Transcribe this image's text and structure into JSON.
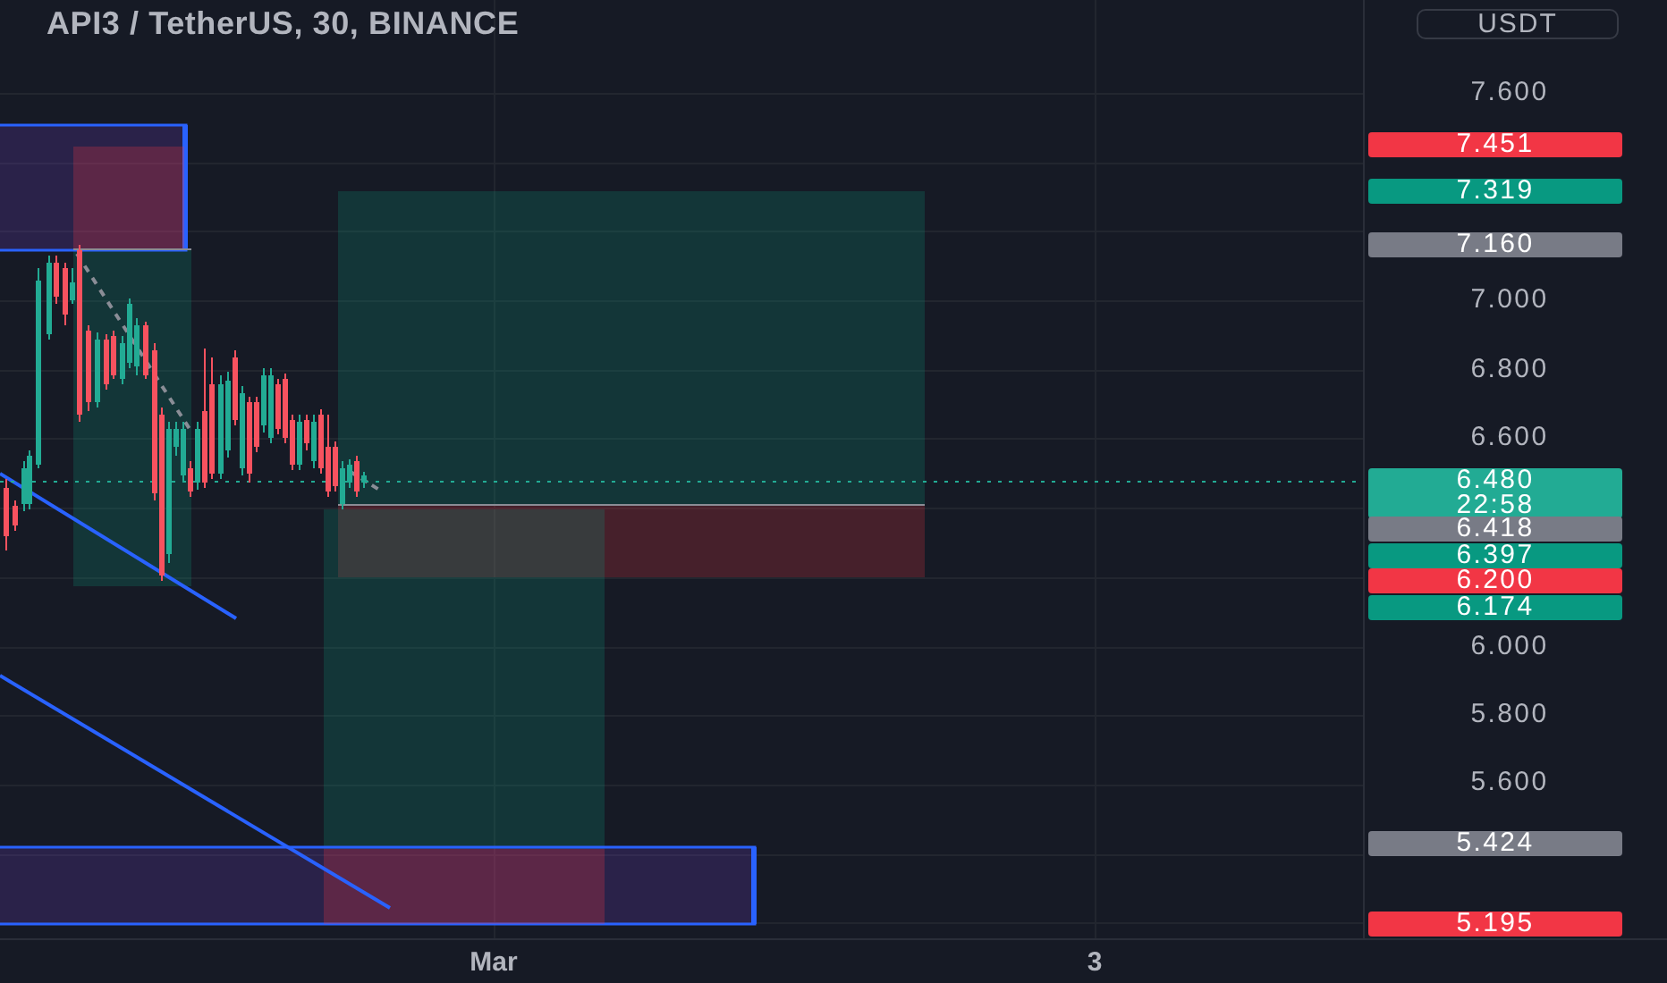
{
  "title": "API3 / TetherUS, 30, BINANCE",
  "currency": "USDT",
  "price_axis": {
    "ticks": [
      "7.600",
      "7.000",
      "6.800",
      "6.600",
      "6.000",
      "5.800",
      "5.600"
    ],
    "labels": [
      {
        "text": "7.451",
        "color": "#f23645"
      },
      {
        "text": "7.319",
        "color": "#089981"
      },
      {
        "text": "7.160",
        "color": "#787b86"
      },
      {
        "text": "6.480",
        "color": "#22ab94",
        "countdown": "22:58"
      },
      {
        "text": "6.418",
        "color": "#787b86"
      },
      {
        "text": "6.397",
        "color": "#089981"
      },
      {
        "text": "6.200",
        "color": "#f23645"
      },
      {
        "text": "6.174",
        "color": "#089981"
      },
      {
        "text": "5.424",
        "color": "#787b86"
      },
      {
        "text": "5.195",
        "color": "#f23645"
      }
    ]
  },
  "time_axis": {
    "labels": [
      "Mar",
      "3"
    ]
  }
}
